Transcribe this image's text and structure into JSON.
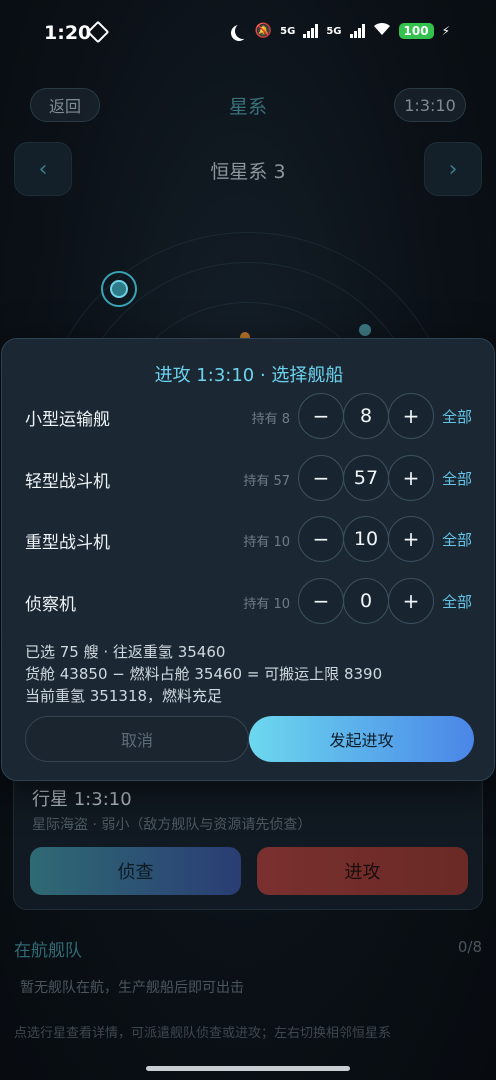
{
  "status_bar": {
    "time": "1:20",
    "signal_1": "5G",
    "signal_2": "5G",
    "battery": "100"
  },
  "header": {
    "back_label": "返回",
    "title": "星系",
    "time_label": "1:3:10",
    "prev_label": "‹",
    "next_label": "›",
    "system_name": "恒星系 3"
  },
  "modal": {
    "title": "进攻 1:3:10 · 选择舰船",
    "minus_label": "−",
    "plus_label": "+",
    "all_label": "全部",
    "ships": [
      {
        "name": "小型运输舰",
        "have": "持有 8",
        "qty": "8"
      },
      {
        "name": "轻型战斗机",
        "have": "持有 57",
        "qty": "57"
      },
      {
        "name": "重型战斗机",
        "have": "持有 10",
        "qty": "10"
      },
      {
        "name": "侦察机",
        "have": "持有 10",
        "qty": "0"
      }
    ],
    "summary": [
      "已选 75 艘 · 往返重氢 35460",
      "货舱 43850 − 燃料占舱 35460 = 可搬运上限 8390",
      "当前重氢 351318，燃料充足"
    ],
    "cancel_label": "取消",
    "launch_label": "发起进攻"
  },
  "planet_card": {
    "title": "行星 1:3:10",
    "subtitle": "星际海盗 · 弱小（敌方舰队与资源请先侦查）",
    "scout_label": "侦查",
    "attack_label": "进攻"
  },
  "fleet": {
    "title": "在航舰队",
    "count": "0/8",
    "empty_text": "暂无舰队在航，生产舰船后即可出击"
  },
  "hint": "点选行星查看详情，可派遣舰队侦查或进攻；左右切换相邻恒星系",
  "colors": {
    "accent": "#6cd3ee",
    "launch_start": "#6cd8ee",
    "launch_end": "#4a86e8",
    "modal_bg": "#1b2733"
  }
}
